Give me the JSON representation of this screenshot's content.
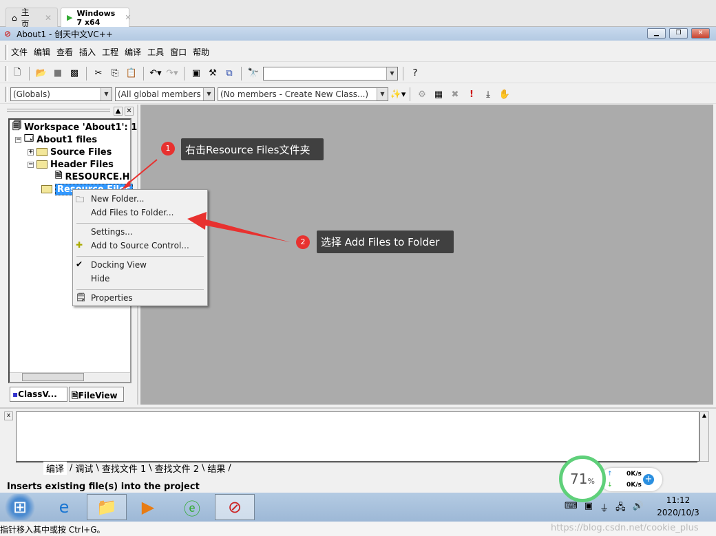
{
  "browser_tabs": [
    {
      "label": "主页",
      "icon": "home-icon"
    },
    {
      "label": "Windows 7 x64",
      "icon": "vm-icon"
    }
  ],
  "window": {
    "title": "About1 - 创天中文VC++"
  },
  "menu": [
    "文件",
    "编辑",
    "查看",
    "插入",
    "工程",
    "编译",
    "工具",
    "窗口",
    "帮助"
  ],
  "toolbar2": {
    "globals": "(Globals)",
    "members": "(All global members",
    "class": "(No members - Create New Class...)"
  },
  "tree": {
    "workspace": "Workspace 'About1': 1",
    "project": "About1 files",
    "source": "Source Files",
    "header": "Header Files",
    "resource_h": "RESOURCE.H",
    "resource": "Resource Files"
  },
  "panel_tabs": [
    "ClassV...",
    "FileView"
  ],
  "context_menu": [
    "New Folder...",
    "Add Files to Folder...",
    "Settings...",
    "Add to Source Control...",
    "Docking View",
    "Hide",
    "Properties"
  ],
  "annotations": [
    {
      "num": "1",
      "text": "右击Resource Files文件夹"
    },
    {
      "num": "2",
      "text": "选择 Add Files to Folder"
    }
  ],
  "output_tabs": [
    "编译",
    "调试",
    "查找文件 1",
    "查找文件 2",
    "结果"
  ],
  "status": "Inserts existing file(s) into the project",
  "net_widget": {
    "percent": "71",
    "unit": "%",
    "up": "0K/s",
    "down": "0K/s"
  },
  "clock": {
    "time": "11:12",
    "date": "2020/10/3"
  },
  "bottom_hint": "指针移入其中或按 Ctrl+G。",
  "watermark": "https://blog.csdn.net/cookie_plus"
}
